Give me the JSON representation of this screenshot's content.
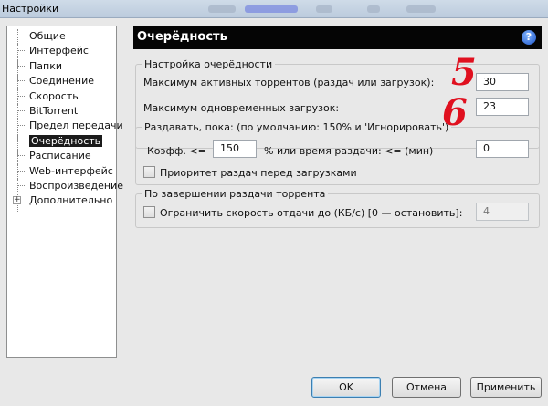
{
  "window": {
    "title": "Настройки"
  },
  "tree": {
    "items": [
      {
        "label": "Общие"
      },
      {
        "label": "Интерфейс"
      },
      {
        "label": "Папки"
      },
      {
        "label": "Соединение"
      },
      {
        "label": "Скорость"
      },
      {
        "label": "BitTorrent"
      },
      {
        "label": "Предел передачи"
      },
      {
        "label": "Очерёдность"
      },
      {
        "label": "Расписание"
      },
      {
        "label": "Web-интерфейс"
      },
      {
        "label": "Воспроизведение"
      },
      {
        "label": "Дополнительно"
      }
    ],
    "selected_index": 7,
    "expander_symbol": "+"
  },
  "panel": {
    "header": "Очерёдность",
    "help_symbol": "?",
    "queue_settings": {
      "legend": "Настройка очерёдности",
      "max_active_label": "Максимум активных торрентов (раздач или загрузок):",
      "max_active_value": "30",
      "max_downloads_label": "Максимум одновременных загрузок:",
      "max_downloads_value": "23"
    },
    "seed_while": {
      "legend": "Раздавать, пока: (по умолчанию: 150% и 'Игнорировать')",
      "ratio_label": "Коэфф. <=",
      "ratio_value": "150",
      "percent_label": "%  или время раздачи: <= (мин)",
      "time_value": "0",
      "priority_label": "Приоритет раздач перед загрузками",
      "priority_checked": false
    },
    "on_seed_complete": {
      "legend": "По завершении раздачи торрента",
      "limit_label": "Ограничить скорость отдачи до (КБ/с) [0 — остановить]:",
      "limit_checked": false,
      "limit_value": "4"
    }
  },
  "annotations": [
    "5",
    "6"
  ],
  "buttons": {
    "ok": "OK",
    "cancel": "Отмена",
    "apply": "Применить"
  },
  "colors": {
    "header_bg": "#050505",
    "annotation": "#e0101f",
    "selected_bg": "#1b1b1b"
  },
  "icons": {
    "help": "help-icon",
    "expander": "expand-plus-icon"
  }
}
